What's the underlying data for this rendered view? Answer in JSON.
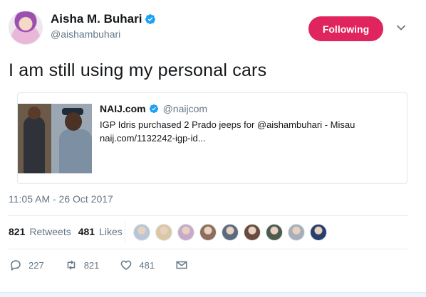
{
  "author": {
    "display_name": "Aisha M. Buhari",
    "handle": "@aishambuhari",
    "verified": true
  },
  "follow_button": {
    "label": "Following",
    "color": "#e0245e"
  },
  "tweet": {
    "text": "I am still using my personal cars",
    "timestamp": "11:05 AM - 26 Oct 2017"
  },
  "quoted": {
    "name": "NAIJ.com",
    "handle": "@naijcom",
    "verified": true,
    "text": "IGP Idris purchased 2 Prado jeeps for @aishambuhari - Misau",
    "link": "naij.com/1132242-igp-id..."
  },
  "stats": {
    "retweets_count": "821",
    "retweets_label": "Retweets",
    "likes_count": "481",
    "likes_label": "Likes"
  },
  "likers": [
    "#b8c6d6",
    "#d9c7a5",
    "#c7a9c9",
    "#8c6e5a",
    "#5b6b7d",
    "#6a4a3e",
    "#4d5a4e",
    "#a7b0ba",
    "#2a3e6b"
  ],
  "actions": {
    "replies": "227",
    "retweets": "821",
    "likes": "481"
  },
  "colors": {
    "accent": "#e0245e",
    "verified": "#1da1f2",
    "muted": "#657786",
    "text": "#14171a"
  }
}
